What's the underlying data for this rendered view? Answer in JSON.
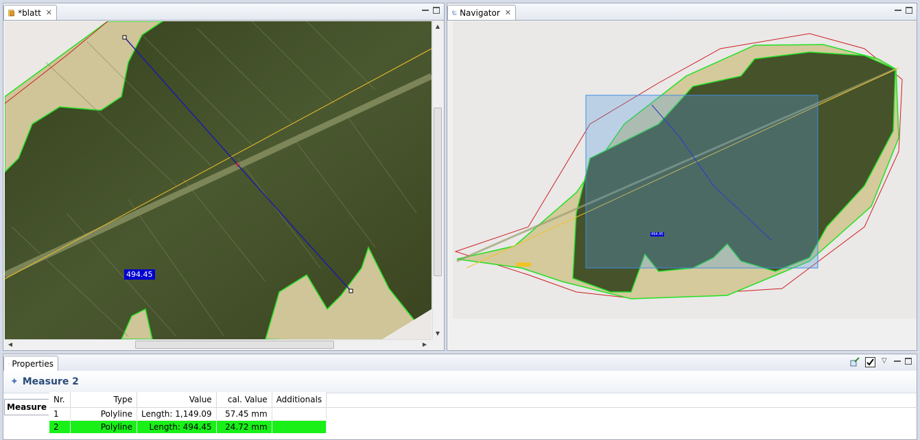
{
  "editor": {
    "tab_label": "*blatt",
    "measure_label": "494.45"
  },
  "navigator": {
    "tab_label": "Navigator",
    "measure_label": "494.45"
  },
  "properties": {
    "tab_label": "Properties",
    "title": "Measure 2",
    "side_tab": "Measure",
    "columns": [
      "Nr.",
      "Type",
      "Value",
      "cal. Value",
      "Additionals"
    ],
    "rows": [
      {
        "nr": "1",
        "type": "Polyline",
        "value": "Length: 1,149.09",
        "cal_value": "57.45 mm",
        "additionals": "",
        "selected": false
      },
      {
        "nr": "2",
        "type": "Polyline",
        "value": "Length: 494.45",
        "cal_value": "24.72 mm",
        "additionals": "",
        "selected": true
      }
    ]
  },
  "colors": {
    "leaf_dark": "#3f4c24",
    "leaf_light": "#d6c99a",
    "outline_green": "#22e022",
    "outline_red": "#cc2020",
    "axis_yellow": "#f2c228",
    "measure_blue": "#1a1aa8",
    "selection_green": "#18f018",
    "title_blue": "#2b4b78"
  }
}
